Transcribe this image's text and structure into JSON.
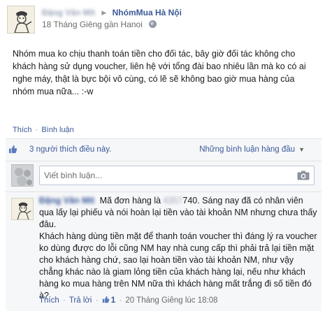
{
  "post": {
    "author_name": "Đặng Văn Mít",
    "group_name": "NhómMua Hà Nội",
    "timestamp": "18 Tháng Giêng gần Hanoi",
    "body": "Nhóm mua ko chịu thanh toán tiền cho đối tác, bây giờ đối tác không cho khách hàng sử dụng voucher, liên hệ với tổng đài bao nhiêu lần mà ko có ai nghe máy, thật là bực bội vô cùng, có lẽ sẽ không bao giờ mua hàng của nhóm mua nữa... :-w",
    "like_label": "Thích",
    "comment_label": "Bình luận"
  },
  "feedback": {
    "likes_text": "3 người thích điều này.",
    "sort_label": "Những bình luận hàng đầu",
    "comment_placeholder": "Viết bình luận..."
  },
  "comment": {
    "author_name": "Đặng Văn Mít",
    "text_prefix": "Mã đơn hàng là ",
    "order_redacted": "4357",
    "order_suffix": "740",
    "text_rest": ". Sáng nay đã có nhân viên qua lấy lại phiếu và nói hoàn lại tiền vào tài khoản NM nhưng chưa thấy đâu.",
    "text_paragraph_2": "Khách hàng dùng tiền mặt để thanh toán voucher thì đáng lý ra voucher ko dùng được do lỗi cũng NM hay nhà cung cấp thì phải trả lại tiền mặt cho khách hàng chứ, sao lại hoàn tiền vào tài khoản NM, như vậy chẳng khác nào là giam lỏng tiền của khách hàng lại, nếu như khách hàng ko mua hàng trên NM nữa thì khách hàng mất trắng đi số tiền đó à?",
    "like_label": "Thích",
    "reply_label": "Trả lời",
    "like_count": "1",
    "timestamp": "20 Tháng Giêng lúc 18:08"
  },
  "colors": {
    "link": "#3b5998",
    "panel_bg": "#f6f7f9",
    "border": "#e1e2e3"
  }
}
